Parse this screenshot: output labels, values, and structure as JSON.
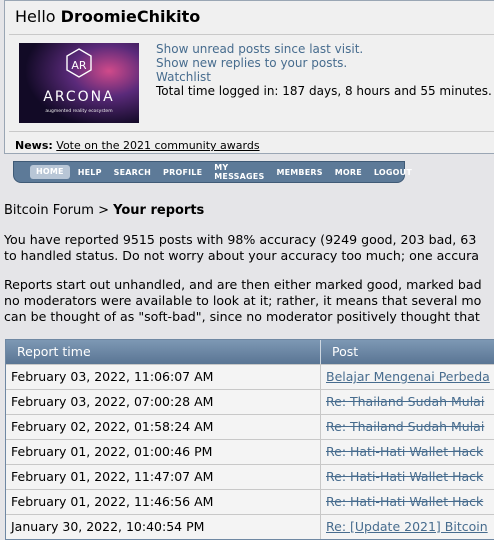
{
  "user": {
    "greeting": "Hello",
    "username": "DroomieChikito",
    "avatar_text": "ARCONA",
    "avatar_subtext": "augmented reality ecosystem",
    "links": [
      "Show unread posts since last visit.",
      "Show new replies to your posts.",
      "Watchlist"
    ],
    "time_logged": "Total time logged in: 187 days, 8 hours and 55 minutes.",
    "news_label": "News:",
    "news_link": "Vote on the 2021 community awards"
  },
  "menu": [
    "HOME",
    "HELP",
    "SEARCH",
    "PROFILE",
    "MY MESSAGES",
    "MEMBERS",
    "MORE",
    "LOGOUT"
  ],
  "breadcrumb": {
    "forum": "Bitcoin Forum",
    "sep": ">",
    "page": "Your reports"
  },
  "para1": [
    "You have reported 9515 posts with 98% accuracy (9249 good, 203 bad, 63",
    "to handled status. Do not worry about your accuracy too much; one accura"
  ],
  "para2": [
    "Reports start out unhandled, and are then either marked good, marked bad",
    "no moderators were available to look at it; rather, it means that several mo",
    "can be thought of as \"soft-bad\", since no moderator positively thought that"
  ],
  "table": {
    "headers": [
      "Report time",
      "Post"
    ],
    "rows": [
      {
        "time": "February 03, 2022, 11:06:07 AM",
        "post": "Belajar Mengenai Perbeda",
        "strike": false
      },
      {
        "time": "February 03, 2022, 07:00:28 AM",
        "post": "Re: Thailand Sudah Mulai",
        "strike": true
      },
      {
        "time": "February 02, 2022, 01:58:24 AM",
        "post": "Re: Thailand Sudah Mulai",
        "strike": true
      },
      {
        "time": "February 01, 2022, 01:00:46 PM",
        "post": "Re: Hati-Hati Wallet Hack",
        "strike": true
      },
      {
        "time": "February 01, 2022, 11:47:07 AM",
        "post": "Re: Hati-Hati Wallet Hack",
        "strike": true
      },
      {
        "time": "February 01, 2022, 11:46:56 AM",
        "post": "Re: Hati-Hati Wallet Hack",
        "strike": true
      },
      {
        "time": "January 30, 2022, 10:40:54 PM",
        "post": "Re: [Update 2021] Bitcoin",
        "strike": false
      }
    ]
  }
}
